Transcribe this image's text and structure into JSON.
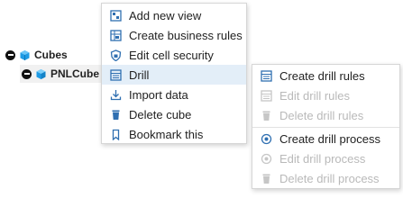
{
  "tree": {
    "root": {
      "label": "Cubes"
    },
    "child": {
      "label": "PNLCube"
    }
  },
  "menu": {
    "items": [
      {
        "label": "Add new view",
        "icon": "add-view-icon"
      },
      {
        "label": "Create business rules",
        "icon": "rules-icon"
      },
      {
        "label": "Edit cell security",
        "icon": "security-shield-icon"
      },
      {
        "label": "Drill",
        "icon": "drill-icon"
      },
      {
        "label": "Import data",
        "icon": "import-icon"
      },
      {
        "label": "Delete cube",
        "icon": "trash-icon"
      },
      {
        "label": "Bookmark this",
        "icon": "bookmark-icon"
      }
    ]
  },
  "submenu": {
    "items": [
      {
        "label": "Create drill rules",
        "icon": "drill-rules-icon",
        "enabled": true
      },
      {
        "label": "Edit drill rules",
        "icon": "drill-rules-icon",
        "enabled": false
      },
      {
        "label": "Delete drill rules",
        "icon": "trash-icon",
        "enabled": false
      },
      {
        "label": "Create drill process",
        "icon": "drill-process-icon",
        "enabled": true
      },
      {
        "label": "Edit drill process",
        "icon": "drill-process-icon",
        "enabled": false
      },
      {
        "label": "Delete drill process",
        "icon": "trash-icon",
        "enabled": false
      }
    ]
  },
  "colors": {
    "accent": "#2f6fb1",
    "icon_blue": "#1f9be5",
    "highlight": "#e3eef8",
    "disabled": "#b9b9b9"
  }
}
